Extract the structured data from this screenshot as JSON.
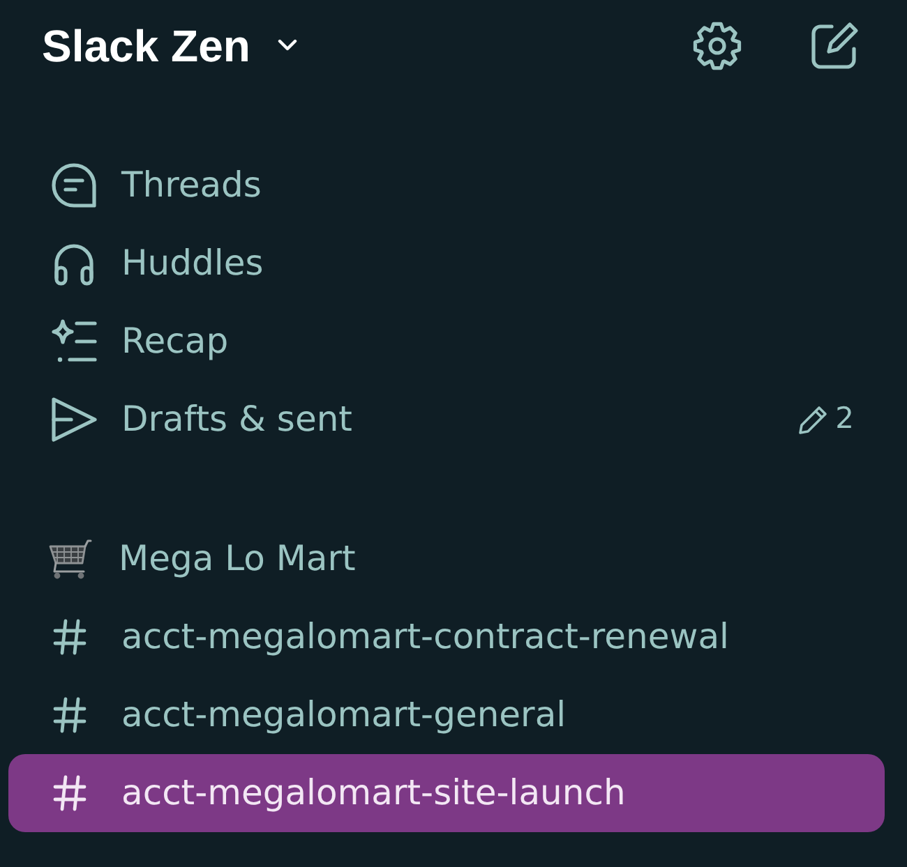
{
  "workspace": {
    "name": "Slack Zen"
  },
  "nav_items": [
    {
      "kind": "threads",
      "label": "Threads"
    },
    {
      "kind": "huddles",
      "label": "Huddles"
    },
    {
      "kind": "recap",
      "label": "Recap"
    },
    {
      "kind": "drafts",
      "label": "Drafts & sent",
      "count": "2"
    }
  ],
  "section": {
    "name": "Mega Lo Mart"
  },
  "channels": [
    {
      "name": "acct-megalomart-contract-renewal",
      "selected": false
    },
    {
      "name": "acct-megalomart-general",
      "selected": false
    },
    {
      "name": "acct-megalomart-site-launch",
      "selected": true
    }
  ]
}
